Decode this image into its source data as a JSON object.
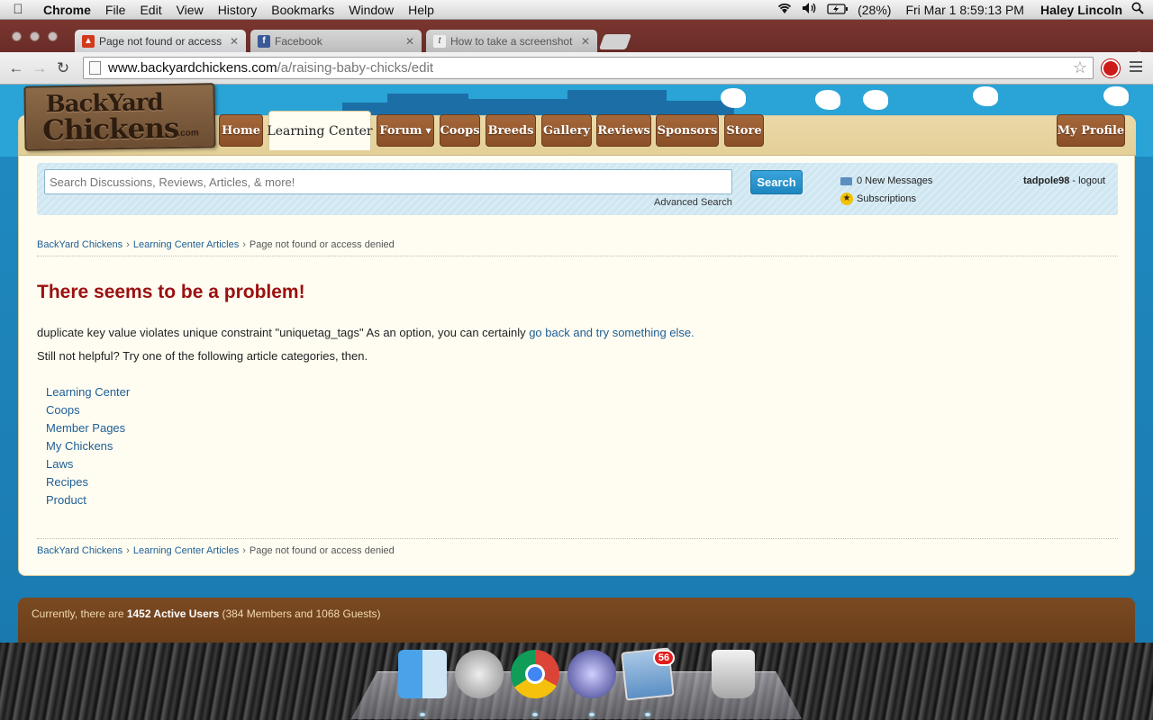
{
  "menubar": {
    "app": "Chrome",
    "items": [
      "File",
      "Edit",
      "View",
      "History",
      "Bookmarks",
      "Window",
      "Help"
    ],
    "battery": "(28%)",
    "datetime": "Fri Mar 1  8:59:13 PM",
    "user": "Haley Lincoln"
  },
  "tabs": [
    {
      "title": "Page not found or access d",
      "active": true
    },
    {
      "title": "Facebook",
      "active": false
    },
    {
      "title": "How to take a screenshot",
      "active": false
    }
  ],
  "omnibox": {
    "host": "www.backyardchickens.com",
    "path": "/a/raising-baby-chicks/edit"
  },
  "site": {
    "logo_line1": "BackYard",
    "logo_line2": "Chickens",
    "logo_suffix": ".com",
    "nav": {
      "home": "Home",
      "learning_center": "Learning Center",
      "forum": "Forum",
      "coops": "Coops",
      "breeds": "Breeds",
      "gallery": "Gallery",
      "reviews": "Reviews",
      "sponsors": "Sponsors",
      "store": "Store",
      "my_profile": "My Profile"
    },
    "search": {
      "placeholder": "Search Discussions, Reviews, Articles, & more!",
      "button": "Search",
      "advanced": "Advanced Search"
    },
    "messages": "0 New Messages",
    "subscriptions": "Subscriptions",
    "username": "tadpole98",
    "logout_sep": " - ",
    "logout": "logout",
    "breadcrumb": {
      "home": "BackYard Chickens",
      "section": "Learning Center Articles",
      "current": "Page not found or access denied"
    },
    "error": {
      "title": "There seems to be a problem!",
      "message": "duplicate key value violates unique constraint \"uniquetag_tags\" As an option, you can certainly ",
      "link": "go back and try something else.",
      "help": "Still not helpful? Try one of the following article categories, then."
    },
    "categories": {
      "learning_center": "Learning Center",
      "coops": "Coops",
      "member_pages": "Member Pages",
      "my_chickens": "My Chickens",
      "laws": "Laws",
      "recipes": "Recipes",
      "product": "Product"
    },
    "active_users": {
      "prefix": "Currently, there are ",
      "count": "1452 Active Users",
      "detail": "  (384 Members and 1068 Guests)"
    }
  },
  "dock": {
    "mail_badge": "56"
  },
  "colors": {
    "tab_strip": "#6a2c27",
    "site_blue": "#2aa3d6",
    "nav_brown": "#8a4f27",
    "error_red": "#9b1010",
    "link_blue": "#1d5d96"
  }
}
